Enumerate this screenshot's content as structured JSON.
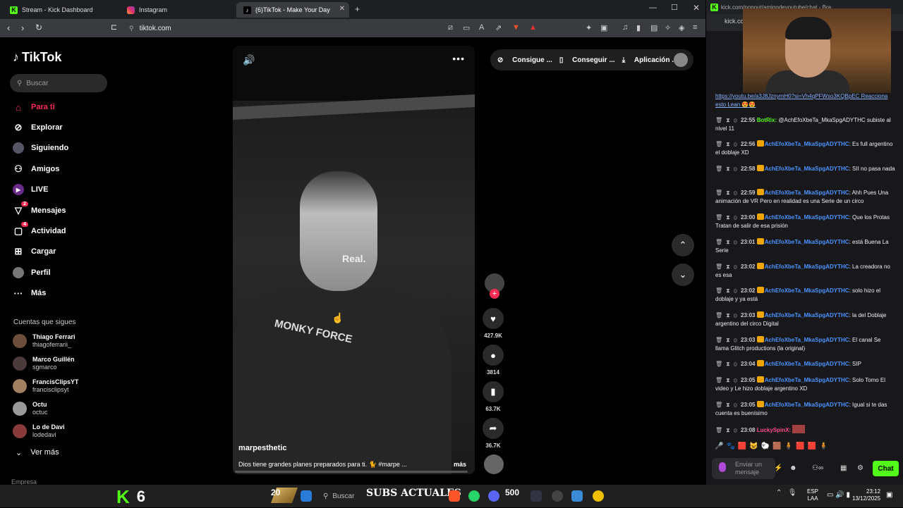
{
  "browser": {
    "tabs": [
      {
        "title": "Stream - Kick Dashboard"
      },
      {
        "title": "Instagram"
      },
      {
        "title": "(6)TikTok - Make Your Day"
      }
    ],
    "url": "tiktok.com"
  },
  "tiktok": {
    "logo": "TikTok",
    "search_placeholder": "Buscar",
    "nav": [
      {
        "label": "Para ti",
        "icon": "home-icon",
        "active": true
      },
      {
        "label": "Explorar",
        "icon": "compass-icon"
      },
      {
        "label": "Siguiendo",
        "icon": "following-avatar-icon"
      },
      {
        "label": "Amigos",
        "icon": "friends-icon"
      },
      {
        "label": "LIVE",
        "icon": "live-icon"
      },
      {
        "label": "Mensajes",
        "icon": "messages-icon",
        "badge": "2"
      },
      {
        "label": "Actividad",
        "icon": "activity-icon",
        "badge": "4"
      },
      {
        "label": "Cargar",
        "icon": "upload-icon"
      },
      {
        "label": "Perfil",
        "icon": "profile-avatar-icon"
      },
      {
        "label": "Más",
        "icon": "more-icon"
      }
    ],
    "following_title": "Cuentas que sigues",
    "accounts": [
      {
        "name": "Thiago Ferrari",
        "handle": "thiagoferrarii_"
      },
      {
        "name": "Marco Guillén",
        "handle": "sgmarco"
      },
      {
        "name": "FrancisClipsYT",
        "handle": "francisclipsyt"
      },
      {
        "name": "Octu",
        "handle": "octuc"
      },
      {
        "name": "Lo de Davi",
        "handle": "lodedavi"
      }
    ],
    "see_more": "Ver más",
    "footer": "Empresa",
    "top_actions": [
      "Consigue ...",
      "Conseguir ...",
      "Aplicación ..."
    ],
    "video": {
      "overlay_text": "Real.",
      "shirt_text": "MONKY FORCE",
      "username": "marpesthetic",
      "description": "Dios tiene grandes planes preparados para ti. 🐈 #marpe ...",
      "more": "más",
      "likes": "427.9K",
      "comments": "3814",
      "saves": "63.7K",
      "shares": "36.7K",
      "progress": 0.0
    }
  },
  "chat": {
    "window_url": "kick.com/popout/amigodeyoutube/chat - Bra...",
    "url_short": "kick.co",
    "messages": [
      {
        "time": "",
        "user": "",
        "text": "https://youtu.be/a3J8JznymH0?si=Vh4qPFWso3KQBpEC Reacciona esto Lean 😍😍"
      },
      {
        "time": "22:55",
        "user": "BotRix",
        "text": "@AchEfoXbeTa_MkaSpgADYTHC subiste al nivel 11"
      },
      {
        "time": "22:56",
        "user": "AchEfoXbeTa_MkaSpgADYTHC",
        "text": "Es full argentino el doblaje XD"
      },
      {
        "time": "22:58",
        "user": "AchEfoXbeTa_MkaSpgADYTHC",
        "text": "SII no pasa nada"
      },
      {
        "time": "22:59",
        "user": "AchEfoXbeTa_MkaSpgADYTHC",
        "text": "Ahh Pues Una animación de VR Pero en realidad es una Serie de un circo"
      },
      {
        "time": "23:00",
        "user": "AchEfoXbeTa_MkaSpgADYTHC",
        "text": "Que los Protas Tratan de salir de esa prisión"
      },
      {
        "time": "23:01",
        "user": "AchEfoXbeTa_MkaSpgADYTHC",
        "text": "está Buena La Serie"
      },
      {
        "time": "23:02",
        "user": "AchEfoXbeTa_MkaSpgADYTHC",
        "text": "La creadora no es esa"
      },
      {
        "time": "23:02",
        "user": "AchEfoXbeTa_MkaSpgADYTHC",
        "text": "solo hizo el doblaje y ya está"
      },
      {
        "time": "23:03",
        "user": "AchEfoXbeTa_MkaSpgADYTHC",
        "text": "la del Doblaje argentino del circo Digital"
      },
      {
        "time": "23:03",
        "user": "AchEfoXbeTa_MkaSpgADYTHC",
        "text": "El canal Se llama Glitch productions (la original)"
      },
      {
        "time": "23:04",
        "user": "AchEfoXbeTa_MkaSpgADYTHC",
        "text": "SIP"
      },
      {
        "time": "23:05",
        "user": "AchEfoXbeTa_MkaSpgADYTHC",
        "text": "Solo Tomo El video y Le hizo doblaje argentino XD"
      },
      {
        "time": "23:05",
        "user": "AchEfoXbeTa_MkaSpgADYTHC",
        "text": "Igual si te das cuenta es buenísimo"
      },
      {
        "time": "23:08",
        "user": "LuckySpinX",
        "text": ""
      }
    ],
    "input_placeholder": "Enviar un mensaje",
    "send_label": "Chat"
  },
  "taskbar": {
    "kick_count": "6",
    "weather": "20",
    "search": "Buscar",
    "subs_label": "SUBS ACTUALES",
    "subs_count": "500",
    "lang": "ESP",
    "lang2": "LAA",
    "time": "23:12",
    "date": "13/12/2025"
  }
}
